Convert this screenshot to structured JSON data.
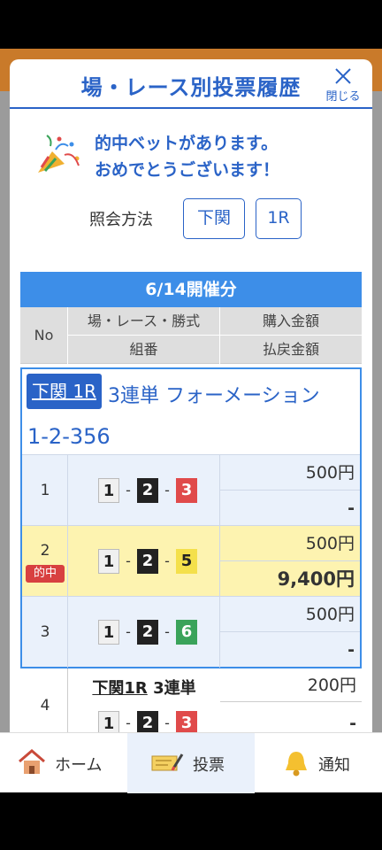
{
  "modal": {
    "title": "場・レース別投票履歴",
    "close_label": "閉じる"
  },
  "hit_message": {
    "line1": "的中ベットがあります。",
    "line2": "おめでとうございます！"
  },
  "query": {
    "label": "照会方法",
    "venue_button": "下関",
    "race_button": "1R"
  },
  "table": {
    "date_header": "6/14開催分",
    "columns": {
      "no": "No",
      "race": "場・レース・勝式",
      "combo": "組番",
      "purchase": "購入金額",
      "payout": "払戻金額"
    },
    "group": {
      "tag": "下関 1R",
      "bet_type": "3連単 フォーメーション",
      "formation": "1-2-356",
      "rows": [
        {
          "no": "1",
          "combo": [
            "1",
            "2",
            "3"
          ],
          "purchase": "500円",
          "payout": "-",
          "hit": ""
        },
        {
          "no": "2",
          "combo": [
            "1",
            "2",
            "5"
          ],
          "purchase": "500円",
          "payout": "9,400円",
          "hit": "的中"
        },
        {
          "no": "3",
          "combo": [
            "1",
            "2",
            "6"
          ],
          "purchase": "500円",
          "payout": "-",
          "hit": ""
        }
      ]
    },
    "row4": {
      "no": "4",
      "venue_race": "下関1R",
      "bet_type": "3連単",
      "combo": [
        "1",
        "2",
        "3"
      ],
      "purchase": "200円",
      "payout": "-"
    }
  },
  "tabbar": {
    "home": "ホーム",
    "vote": "投票",
    "notify": "通知"
  },
  "colors": {
    "accent": "#2a63c7",
    "header_bar": "#3d8ee8",
    "hit_row": "#fdf3b0",
    "hit_badge": "#d84040"
  }
}
